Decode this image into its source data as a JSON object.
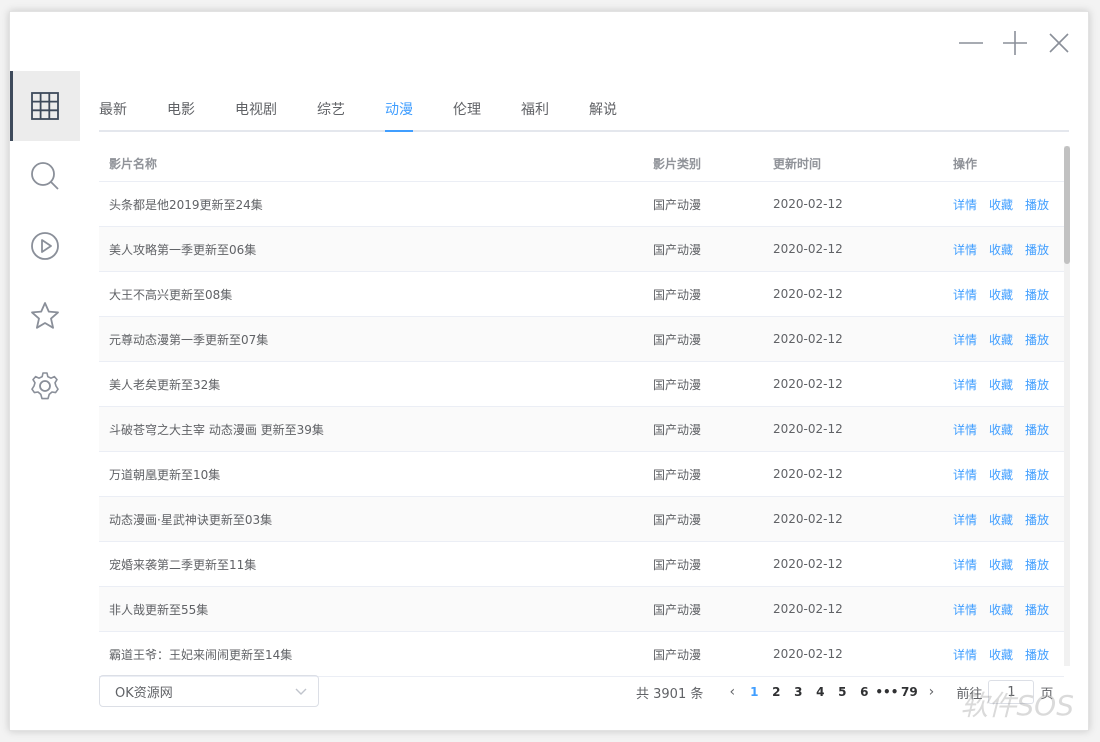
{
  "window_controls": {
    "minimize": "minimize",
    "maximize": "maximize",
    "close": "close"
  },
  "sidebar": {
    "items": [
      {
        "name": "grid-icon",
        "active": true
      },
      {
        "name": "search-icon",
        "active": false
      },
      {
        "name": "play-icon",
        "active": false
      },
      {
        "name": "star-icon",
        "active": false
      },
      {
        "name": "gear-icon",
        "active": false
      }
    ]
  },
  "tabs": [
    "最新",
    "电影",
    "电视剧",
    "综艺",
    "动漫",
    "伦理",
    "福利",
    "解说"
  ],
  "active_tab": 4,
  "table": {
    "headers": {
      "name": "影片名称",
      "type": "影片类别",
      "time": "更新时间",
      "ops": "操作"
    },
    "ops": {
      "detail": "详情",
      "favorite": "收藏",
      "play": "播放"
    },
    "rows": [
      {
        "name": "头条都是他2019更新至24集",
        "type": "国产动漫",
        "time": "2020-02-12"
      },
      {
        "name": "美人攻略第一季更新至06集",
        "type": "国产动漫",
        "time": "2020-02-12"
      },
      {
        "name": "大王不高兴更新至08集",
        "type": "国产动漫",
        "time": "2020-02-12"
      },
      {
        "name": "元尊动态漫第一季更新至07集",
        "type": "国产动漫",
        "time": "2020-02-12"
      },
      {
        "name": "美人老矣更新至32集",
        "type": "国产动漫",
        "time": "2020-02-12"
      },
      {
        "name": "斗破苍穹之大主宰 动态漫画 更新至39集",
        "type": "国产动漫",
        "time": "2020-02-12"
      },
      {
        "name": "万道朝凰更新至10集",
        "type": "国产动漫",
        "time": "2020-02-12"
      },
      {
        "name": "动态漫画·星武神诀更新至03集",
        "type": "国产动漫",
        "time": "2020-02-12"
      },
      {
        "name": "宠婚来袭第二季更新至11集",
        "type": "国产动漫",
        "time": "2020-02-12"
      },
      {
        "name": "非人哉更新至55集",
        "type": "国产动漫",
        "time": "2020-02-12"
      },
      {
        "name": "霸道王爷：王妃来闹闹更新至14集",
        "type": "国产动漫",
        "time": "2020-02-12"
      }
    ]
  },
  "source_select": {
    "value": "OK资源网"
  },
  "pagination": {
    "total": "共 3901 条",
    "pages": [
      "1",
      "2",
      "3",
      "4",
      "5",
      "6",
      "•••",
      "79"
    ],
    "current": "1",
    "goto_label": "前往",
    "goto_value": "1",
    "page_suffix": "页"
  },
  "watermark": "软件SOS",
  "colors": {
    "accent": "#409eff",
    "sidebar_active_bar": "#3e4a5b",
    "icon": "#8a8f99"
  }
}
